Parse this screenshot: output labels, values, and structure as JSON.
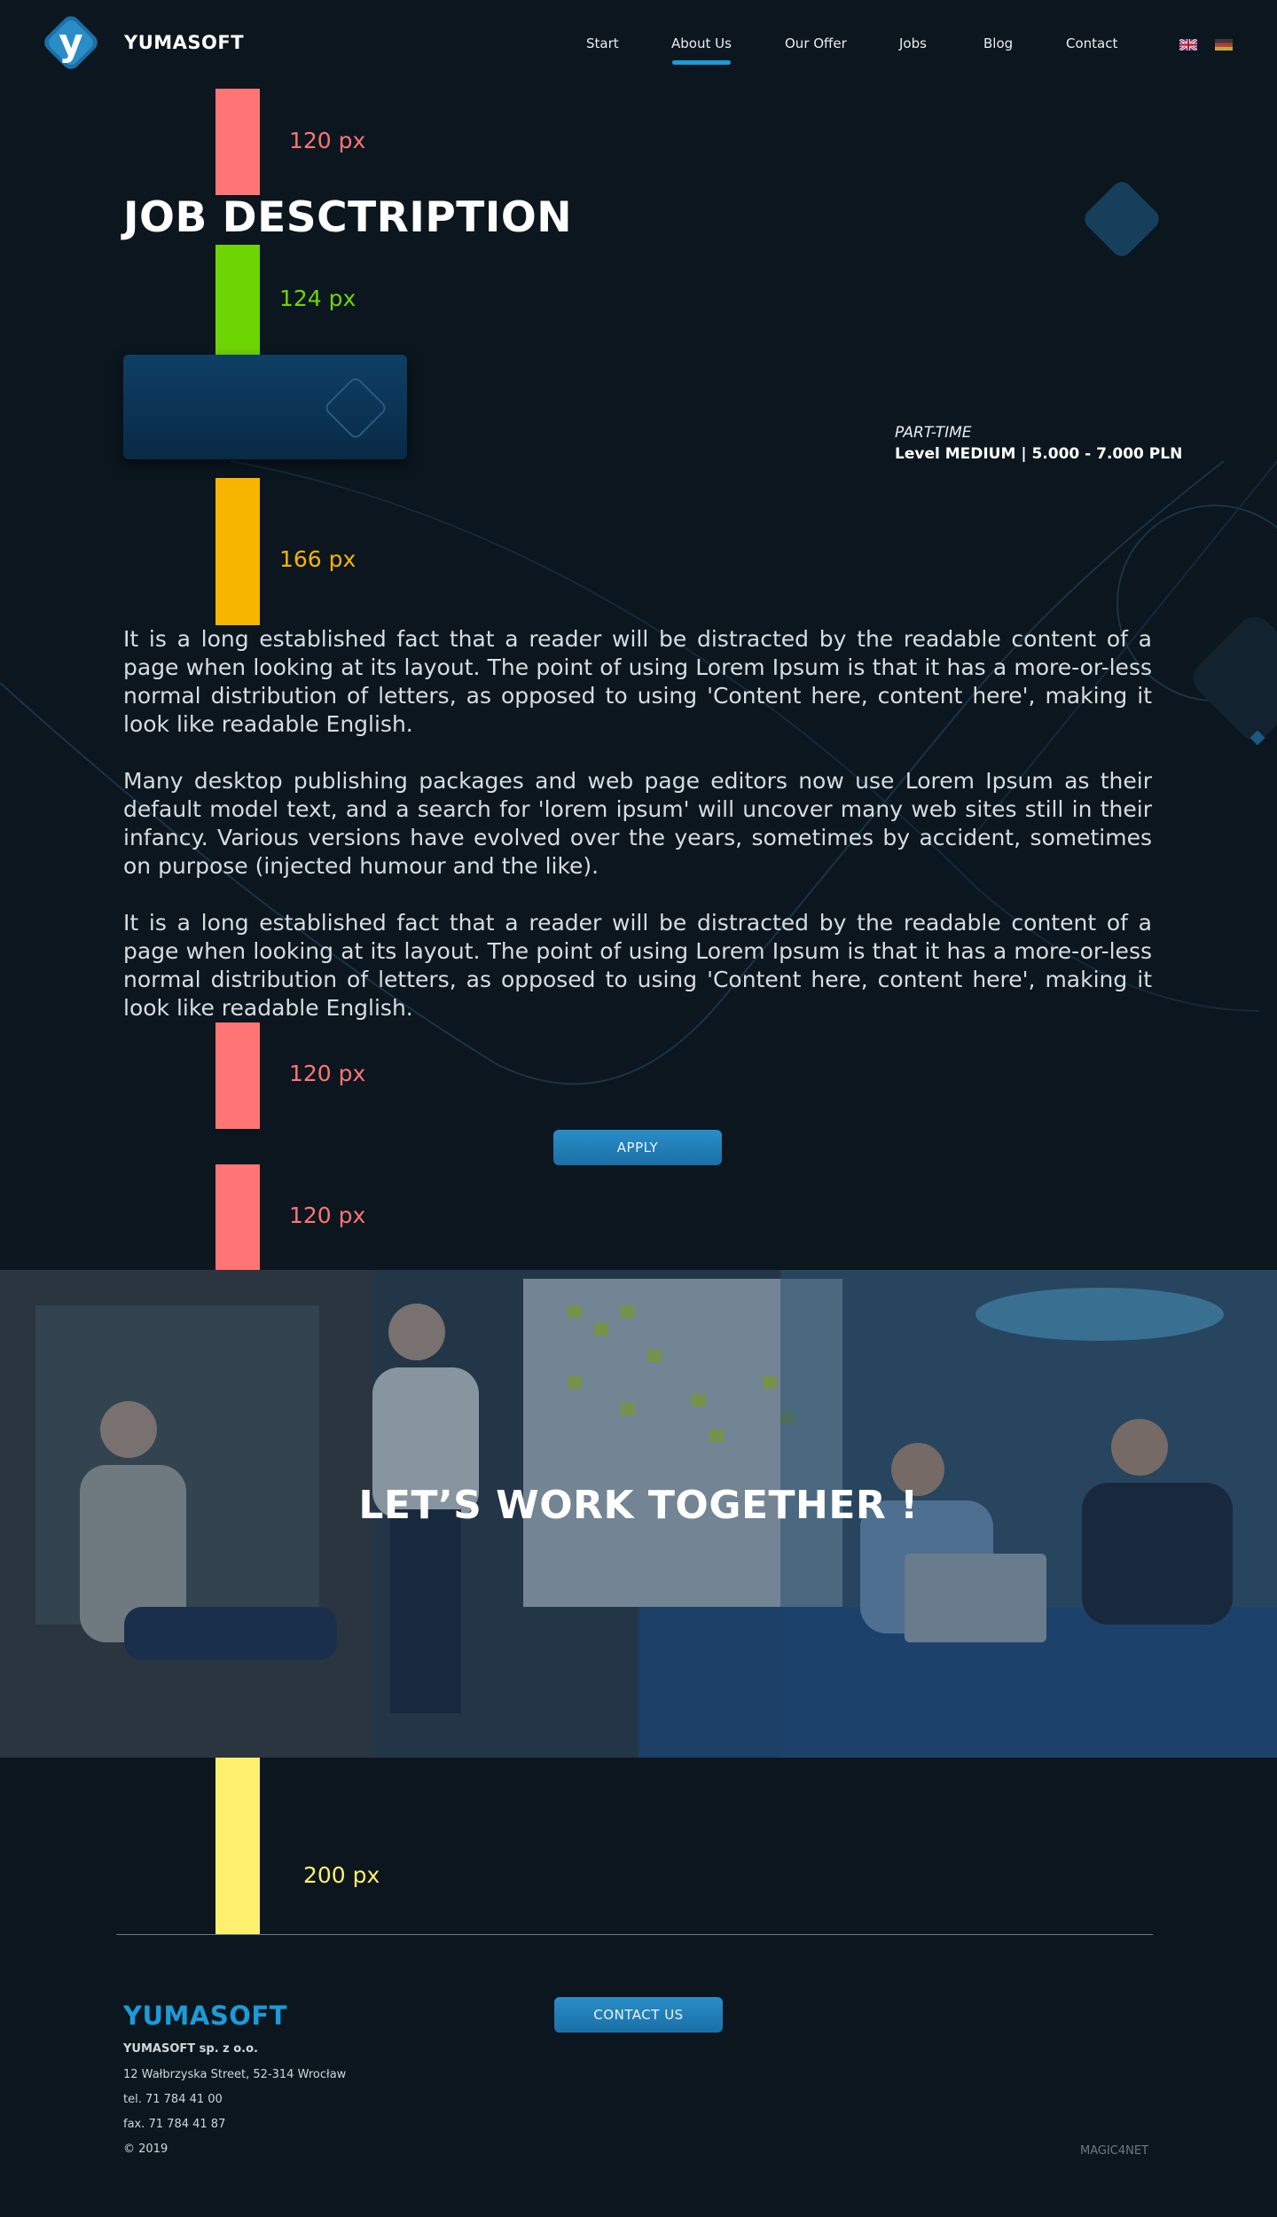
{
  "brand": "YUMASOFT",
  "nav": {
    "items": [
      "Start",
      "About Us",
      "Our Offer",
      "Jobs",
      "Blog",
      "Contact"
    ],
    "active": "About Us"
  },
  "colors": {
    "background": "#0b161e",
    "accent": "#1b9bd7",
    "spacer_120": "#ff7474",
    "spacer_124": "#6ed505",
    "spacer_166": "#f7b500",
    "spacer_200": "#fff06e"
  },
  "spacers": {
    "s1": "120 px",
    "s2": "124 px",
    "s3": "166 px",
    "s4": "120 px",
    "s5": "120 px",
    "s6": "200 px"
  },
  "job": {
    "title": "JOB DESCTRIPTION",
    "type": "PART-TIME",
    "level": "Level MEDIUM | 5.000 - 7.000 PLN",
    "paragraphs": [
      "It is a long established fact that a reader will be distracted by the readable content of a page when looking at its layout. The point of using Lorem Ipsum is that it has a more-or-less normal distribution of letters, as opposed to using 'Content here, content here', making it look like readable English.",
      "Many desktop publishing packages and web page editors now use Lorem Ipsum as their default model text, and a search for 'lorem ipsum' will uncover many web sites still in their infancy. Various versions have evolved over the years, sometimes by accident, sometimes on purpose (injected humour and the like).",
      "It is a long established fact that a reader will be distracted by the readable content of a page when looking at its layout. The point of using Lorem Ipsum is that it has a more-or-less normal distribution of letters, as opposed to using 'Content here, content here', making it look like readable English."
    ],
    "apply_label": "APPLY"
  },
  "banner": {
    "title": "LET’S WORK TOGETHER !"
  },
  "footer": {
    "brand": "YUMASOFT",
    "contact_label": "CONTACT US",
    "company": "YUMASOFT sp. z o.o.",
    "address": "12 Wałbrzyska Street, 52-314 Wrocław",
    "tel": "tel. 71 784 41 00",
    "fax": "fax. 71 784 41 87",
    "copyright": "© 2019",
    "credit": "MAGIC4NET"
  },
  "icons": {
    "logo": "yumasoft-logo-icon",
    "flag_en": "uk-flag-icon",
    "flag_de": "german-flag-icon"
  }
}
